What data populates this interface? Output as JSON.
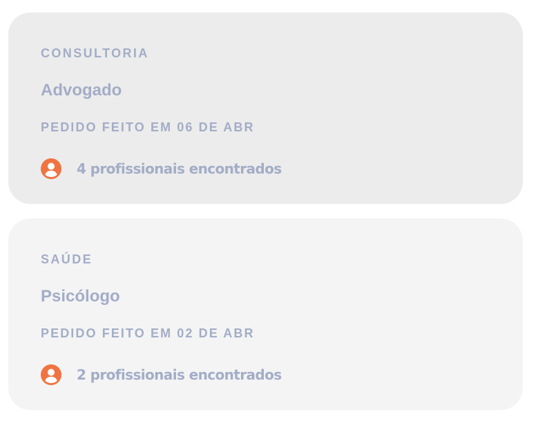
{
  "colors": {
    "card_1_bg": "#ececec",
    "card_2_bg": "#f4f4f4",
    "text": "#a3adc7",
    "icon_accent": "#f07442"
  },
  "orders": [
    {
      "category": "CONSULTORIA",
      "title": "Advogado",
      "date_label": "PEDIDO FEITO EM 06 DE ABR",
      "icon": "user-circle-icon",
      "professionals_text": "4 profissionais encontrados"
    },
    {
      "category": "SAÚDE",
      "title": "Psicólogo",
      "date_label": "PEDIDO FEITO EM 02 DE ABR",
      "icon": "user-circle-icon",
      "professionals_text": "2 profissionais encontrados"
    }
  ]
}
